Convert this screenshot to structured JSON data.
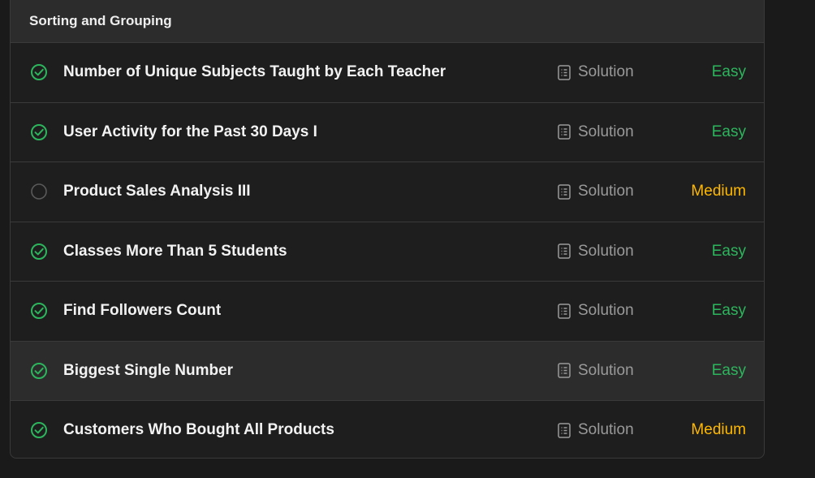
{
  "section": {
    "title": "Sorting and Grouping"
  },
  "colors": {
    "easy": "#2db55d",
    "medium": "#ffb800",
    "solved": "#2db55d"
  },
  "problems": [
    {
      "title": "Number of Unique Subjects Taught by Each Teacher",
      "solution_label": "Solution",
      "difficulty": "Easy",
      "solved": true
    },
    {
      "title": "User Activity for the Past 30 Days I",
      "solution_label": "Solution",
      "difficulty": "Easy",
      "solved": true
    },
    {
      "title": "Product Sales Analysis III",
      "solution_label": "Solution",
      "difficulty": "Medium",
      "solved": false
    },
    {
      "title": "Classes More Than 5 Students",
      "solution_label": "Solution",
      "difficulty": "Easy",
      "solved": true
    },
    {
      "title": "Find Followers Count",
      "solution_label": "Solution",
      "difficulty": "Easy",
      "solved": true
    },
    {
      "title": "Biggest Single Number",
      "solution_label": "Solution",
      "difficulty": "Easy",
      "solved": true,
      "highlighted": true
    },
    {
      "title": "Customers Who Bought All Products",
      "solution_label": "Solution",
      "difficulty": "Medium",
      "solved": true
    }
  ]
}
